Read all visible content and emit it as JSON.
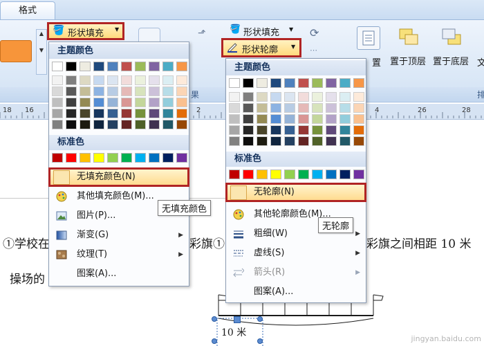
{
  "ribbon": {
    "tab_format": "格式",
    "shape_fill": "形状填充",
    "shape_outline": "形状轮廓",
    "group_label_center": "果",
    "bring_top": "置于顶层",
    "send_bottom": "置于底层",
    "cut_text_left": "置",
    "cut_text_right": "文",
    "cut_group_right": "排"
  },
  "ruler": {
    "ticks": [
      "18",
      "16",
      "2",
      "2",
      "4",
      "26",
      "28"
    ]
  },
  "document": {
    "line1_left": "①学校在",
    "line1_mid": "彩旗①",
    "line1_right": "彩旗之间相距 10 米",
    "line2_left": "操场的",
    "distance_label": "10 米"
  },
  "fill_menu": {
    "theme_header": "主题颜色",
    "standard_header": "标准色",
    "no_fill": "无填充颜色(N)",
    "more_colors": "其他填充颜色(M)...",
    "picture": "图片(P)...",
    "gradient": "渐变(G)",
    "texture": "纹理(T)",
    "pattern": "图案(A)...",
    "tooltip": "无填充颜色"
  },
  "outline_menu": {
    "theme_header": "主题颜色",
    "standard_header": "标准色",
    "no_outline": "无轮廓(N)",
    "more_colors": "其他轮廓颜色(M)...",
    "weight": "粗细(W)",
    "dashes": "虚线(S)",
    "arrows": "箭头(R)",
    "pattern": "图案(A)...",
    "tooltip": "无轮廓"
  },
  "colors": {
    "theme_top": [
      "#ffffff",
      "#000000",
      "#eeece1",
      "#1f497d",
      "#4f81bd",
      "#c0504d",
      "#9bbb59",
      "#8064a2",
      "#4bacc6",
      "#f79646"
    ],
    "theme_shades": [
      [
        "#f2f2f2",
        "#d9d9d9",
        "#bfbfbf",
        "#a6a6a6",
        "#808080"
      ],
      [
        "#7f7f7f",
        "#595959",
        "#3f3f3f",
        "#262626",
        "#0d0d0d"
      ],
      [
        "#ddd9c3",
        "#c4bd97",
        "#948a54",
        "#4a452a",
        "#1d1b10"
      ],
      [
        "#c6d9f0",
        "#8db3e2",
        "#548dd4",
        "#17365d",
        "#0f243e"
      ],
      [
        "#dbe5f1",
        "#b8cce4",
        "#95b3d7",
        "#366092",
        "#244061"
      ],
      [
        "#f2dcdb",
        "#e5b9b7",
        "#d99694",
        "#953734",
        "#632423"
      ],
      [
        "#ebf1dd",
        "#d7e3bc",
        "#c3d69b",
        "#76923c",
        "#4f6128"
      ],
      [
        "#e5e0ec",
        "#ccc1d9",
        "#b2a2c7",
        "#5f497a",
        "#3f3151"
      ],
      [
        "#dbeef3",
        "#b7dde8",
        "#92cddc",
        "#31859b",
        "#205867"
      ],
      [
        "#fdeada",
        "#fbd5b5",
        "#fac08f",
        "#e36c09",
        "#974806"
      ]
    ],
    "standard": [
      "#c00000",
      "#ff0000",
      "#ffc000",
      "#ffff00",
      "#92d050",
      "#00b050",
      "#00b0f0",
      "#0070c0",
      "#002060",
      "#7030a0"
    ],
    "highlight_border": "#b02424",
    "ribbon_orange": "#f7953a"
  },
  "icons": [
    "paint-bucket-icon",
    "pen-outline-icon",
    "smiley-palette-icon",
    "picture-icon",
    "gradient-icon",
    "texture-icon",
    "line-weight-icon",
    "dash-icon",
    "arrow-style-icon",
    "bring-to-front-icon",
    "send-to-back-icon",
    "chevron-right-icon",
    "dropdown-arrow-icon"
  ],
  "watermark": "jingyan.baidu.com"
}
